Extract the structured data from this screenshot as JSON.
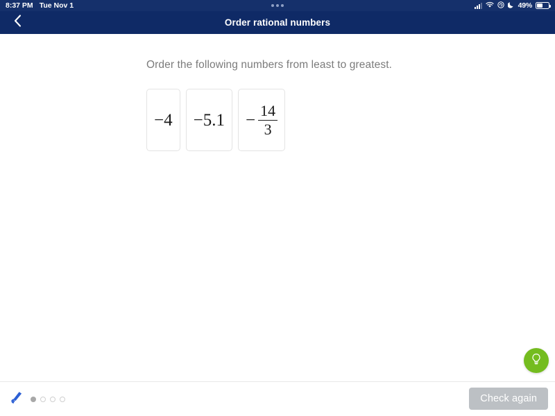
{
  "status_bar": {
    "time": "8:37 PM",
    "date": "Tue Nov 1",
    "battery_percent": "49%",
    "icons": [
      "cellular-signal-icon",
      "wifi-icon",
      "orientation-lock-icon",
      "do-not-disturb-moon-icon",
      "battery-icon"
    ],
    "multitask_dots": 3,
    "background_color": "#15306b"
  },
  "nav_bar": {
    "back_label": "‹",
    "title": "Order rational numbers",
    "background_color": "#0f2a66"
  },
  "exercise": {
    "prompt": "Order the following numbers from least to greatest.",
    "cards": [
      {
        "type": "plain",
        "text": "−4",
        "name": "value-card-negative-4"
      },
      {
        "type": "plain",
        "text": "−5.1",
        "name": "value-card-negative-5-1"
      },
      {
        "type": "fraction",
        "sign": "−",
        "numerator": "14",
        "denominator": "3",
        "name": "value-card-negative-14-over-3"
      }
    ]
  },
  "hint": {
    "icon": "lightbulb-icon",
    "color": "#74bc1f"
  },
  "footer": {
    "pen_icon": "scribble-pen-icon",
    "progress_dots": [
      {
        "state": "filled"
      },
      {
        "state": "empty"
      },
      {
        "state": "empty"
      },
      {
        "state": "empty"
      }
    ],
    "check_button_label": "Check again",
    "check_button_color": "#bcc0c4"
  }
}
